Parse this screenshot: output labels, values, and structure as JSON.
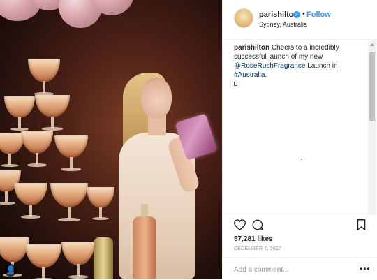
{
  "post": {
    "username": "parishilton",
    "follow_label": "Follow",
    "separator": "•",
    "location": "Sydney, Australia",
    "caption": {
      "username": "parishilton",
      "text_1": " Cheers to a incredibly successful launch of my new ",
      "mention": "@RoseRushFragrance",
      "text_2": " Launch in ",
      "hashtag": "#Australia",
      "text_3": "."
    },
    "likes": "57,281 likes",
    "date": "December 1, 2017",
    "comment_placeholder": "Add a comment...",
    "more_label": "•••",
    "verified_glyph": "✓",
    "photo_badge_glyph": "👤"
  },
  "colors": {
    "link": "#003569",
    "follow": "#3897f0",
    "text": "#262626",
    "muted": "#999999",
    "border": "#efefef"
  },
  "icons": {
    "heart": "heart-icon",
    "comment": "comment-icon",
    "bookmark": "bookmark-icon",
    "verified": "verified-badge-icon",
    "more": "more-options-icon"
  }
}
